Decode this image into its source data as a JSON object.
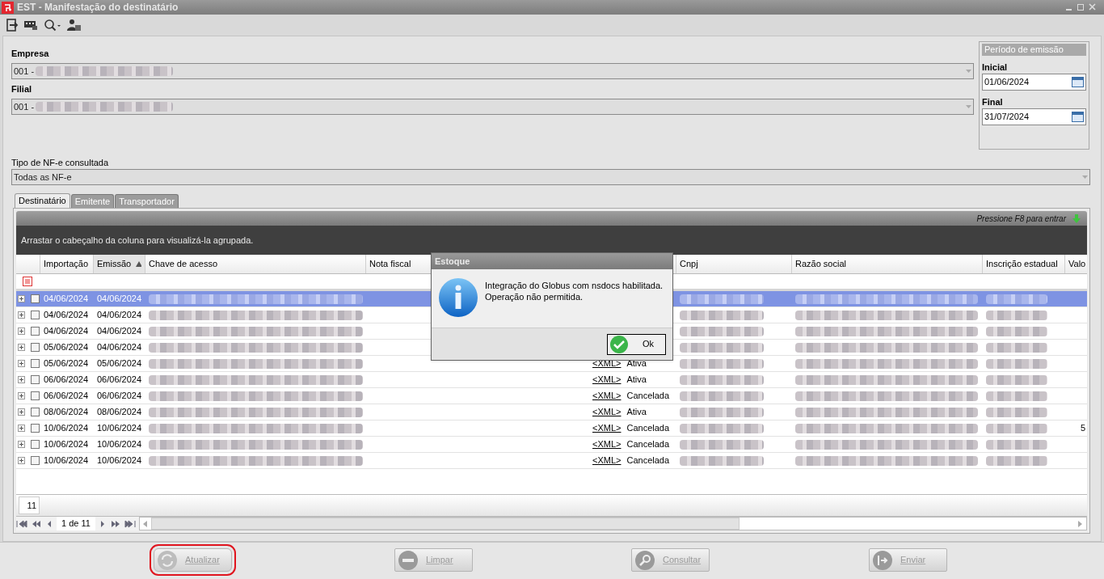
{
  "window": {
    "title": "EST - Manifestação do destinatário"
  },
  "fields": {
    "empresa": {
      "label": "Empresa",
      "value": "001 -"
    },
    "filial": {
      "label": "Filial",
      "value": "001 -"
    },
    "tipo": {
      "label": "Tipo de NF-e consultada",
      "value": "Todas as NF-e"
    }
  },
  "periodo": {
    "title": "Período de emissão",
    "inicial": {
      "label": "Inicial",
      "value": "01/06/2024"
    },
    "final": {
      "label": "Final",
      "value": "31/07/2024"
    }
  },
  "tabs": [
    {
      "label": "Destinatário",
      "selected": true
    },
    {
      "label": "Emitente",
      "selected": false
    },
    {
      "label": "Transportador",
      "selected": false
    }
  ],
  "grid": {
    "hint": "Pressione F8 para entrar",
    "group_hint": "Arrastar o cabeçalho da coluna para visualizá-la agrupada.",
    "columns": [
      {
        "label": "Importação",
        "sorted": false
      },
      {
        "label": "Emissão",
        "sorted": true
      },
      {
        "label": "Chave de acesso",
        "sorted": false
      },
      {
        "label": "Nota fiscal",
        "sorted": false
      },
      {
        "label": "Cnpj",
        "sorted": false
      },
      {
        "label": "Razão social",
        "sorted": false
      },
      {
        "label": "Inscrição estadual",
        "sorted": false
      },
      {
        "label": "Valo",
        "sorted": false
      }
    ],
    "rows": [
      {
        "importacao": "04/06/2024",
        "emissao": "04/06/2024",
        "selected": true,
        "checked": false
      },
      {
        "importacao": "04/06/2024",
        "emissao": "04/06/2024",
        "selected": false,
        "checked": false
      },
      {
        "importacao": "04/06/2024",
        "emissao": "04/06/2024",
        "selected": false,
        "checked": false
      },
      {
        "importacao": "05/06/2024",
        "emissao": "04/06/2024",
        "selected": false,
        "checked": false
      },
      {
        "importacao": "05/06/2024",
        "emissao": "05/06/2024",
        "xml": "<XML>",
        "status": "Ativa",
        "selected": false,
        "checked": false
      },
      {
        "importacao": "06/06/2024",
        "emissao": "06/06/2024",
        "xml": "<XML>",
        "status": "Ativa",
        "selected": false,
        "checked": false
      },
      {
        "importacao": "06/06/2024",
        "emissao": "06/06/2024",
        "xml": "<XML>",
        "status": "Cancelada",
        "selected": false,
        "checked": false
      },
      {
        "importacao": "08/06/2024",
        "emissao": "08/06/2024",
        "xml": "<XML>",
        "status": "Ativa",
        "selected": false,
        "checked": false
      },
      {
        "importacao": "10/06/2024",
        "emissao": "10/06/2024",
        "xml": "<XML>",
        "status": "Cancelada",
        "valor": "5",
        "selected": false,
        "checked": false
      },
      {
        "importacao": "10/06/2024",
        "emissao": "10/06/2024",
        "xml": "<XML>",
        "status": "Cancelada",
        "selected": false,
        "checked": false
      },
      {
        "importacao": "10/06/2024",
        "emissao": "10/06/2024",
        "xml": "<XML>",
        "status": "Cancelada",
        "selected": false,
        "checked": false
      }
    ],
    "count": "11",
    "pager": "1 de 11"
  },
  "buttons": [
    {
      "label": "Atualizar",
      "disabled": true,
      "focused": true
    },
    {
      "label": "Limpar",
      "disabled": true,
      "focused": false
    },
    {
      "label": "Consultar",
      "disabled": true,
      "focused": false
    },
    {
      "label": "Enviar",
      "disabled": true,
      "focused": false
    }
  ],
  "dialog": {
    "title": "Estoque",
    "message": "Integração do Globus com nsdocs habilitada.\nOperação não permitida.",
    "button": "Ok"
  }
}
